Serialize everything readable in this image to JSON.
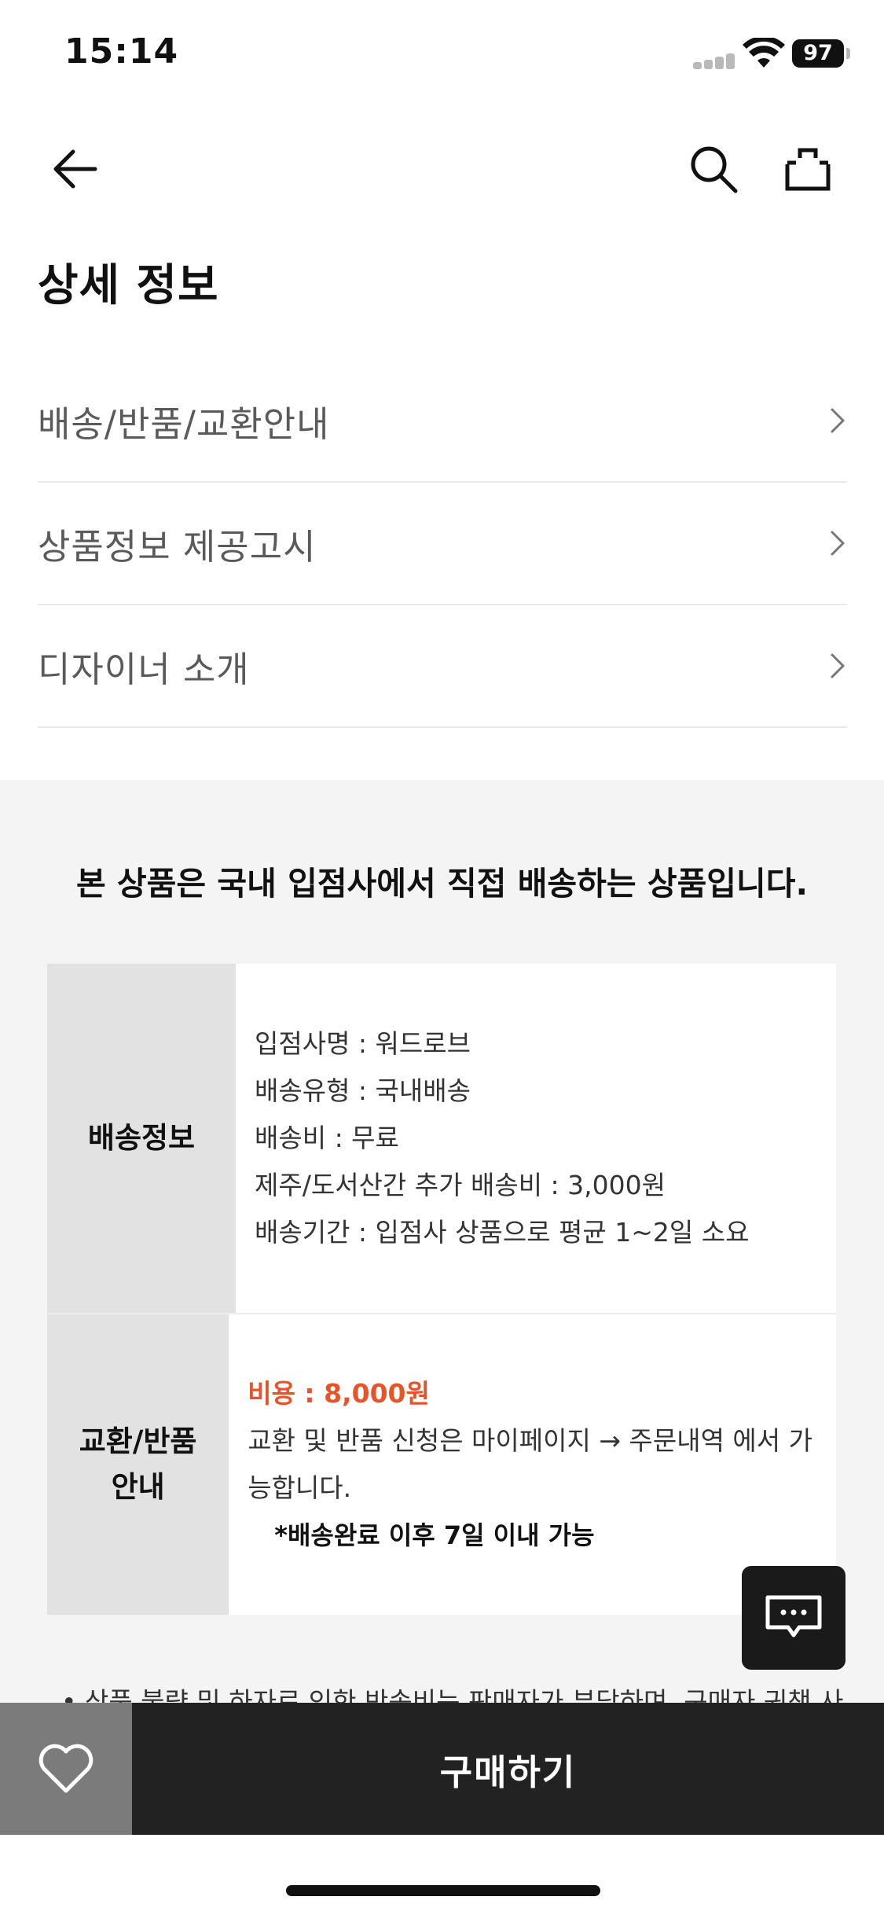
{
  "status_bar": {
    "time": "15:14",
    "battery": "97"
  },
  "page": {
    "title": "상세 정보"
  },
  "menu": {
    "items": [
      {
        "label": "배송/반품/교환안내"
      },
      {
        "label": "상품정보 제공고시"
      },
      {
        "label": "디자이너 소개"
      }
    ]
  },
  "notice": {
    "title": "본 상품은 국내 입점사에서 직접 배송하는 상품입니다.",
    "shipping": {
      "head": "배송정보",
      "lines": [
        "입점사명 : 워드로브",
        "배송유형 : 국내배송",
        "배송비 : 무료",
        "제주/도서산간 추가 배송비 : 3,000원",
        "배송기간 : 입점사 상품으로 평균 1~2일 소요"
      ]
    },
    "exchange": {
      "head_line1": "교환/반품",
      "head_line2": "안내",
      "cost": "비용 : 8,000원",
      "line1": "교환 및 반품 신청은 마이페이지 → 주문내역 에서 가",
      "line2": "능합니다.",
      "note": "*배송완료 이후 7일 이내 가능"
    },
    "bullet": "• 상품 불량 및 하자로 인한 반송비는 판매자가 부담하며, 구매자 귀책 사"
  },
  "bottom_bar": {
    "buy_label": "구매하기"
  },
  "icons": {
    "back": "arrow-left-icon",
    "search": "search-icon",
    "bag": "shopping-bag-icon",
    "chat": "chat-bubble-icon",
    "wish": "heart-icon"
  },
  "colors": {
    "accent": "#e8542a",
    "buy_bg": "#222222",
    "wish_bg": "#7b7b7b"
  }
}
